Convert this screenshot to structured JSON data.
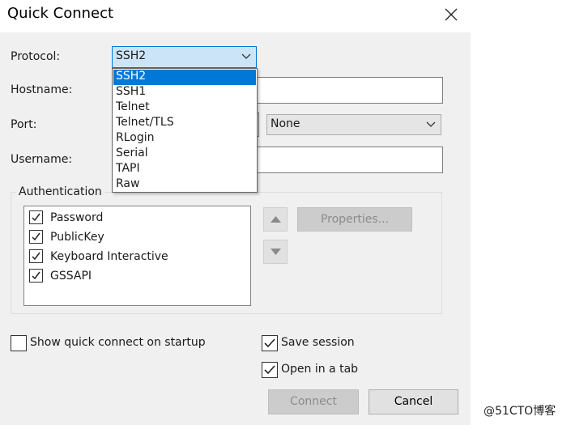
{
  "window": {
    "title": "Quick Connect"
  },
  "form": {
    "protocol_label": "Protocol:",
    "protocol_value": "SSH2",
    "hostname_label": "Hostname:",
    "hostname_value": "",
    "port_label": "Port:",
    "firewall_value": "None",
    "username_label": "Username:",
    "username_value": ""
  },
  "protocol_dropdown": {
    "options": [
      "SSH2",
      "SSH1",
      "Telnet",
      "Telnet/TLS",
      "RLogin",
      "Serial",
      "TAPI",
      "Raw"
    ],
    "selected": "SSH2"
  },
  "authentication": {
    "title": "Authentication",
    "methods": [
      {
        "label": "Password",
        "checked": true
      },
      {
        "label": "PublicKey",
        "checked": true
      },
      {
        "label": "Keyboard Interactive",
        "checked": true
      },
      {
        "label": "GSSAPI",
        "checked": true
      }
    ],
    "properties_label": "Properties..."
  },
  "options": {
    "show_quick_connect_label": "Show quick connect on startup",
    "show_quick_connect_checked": false,
    "save_session_label": "Save session",
    "save_session_checked": true,
    "open_in_tab_label": "Open in a tab",
    "open_in_tab_checked": true
  },
  "buttons": {
    "connect_label": "Connect",
    "cancel_label": "Cancel"
  },
  "watermark": {
    "text": "@51CTO博客"
  },
  "colors": {
    "accent": "#0078d7",
    "focus_fill": "#cce4f7",
    "dialog_bg": "#f0f0f0"
  }
}
